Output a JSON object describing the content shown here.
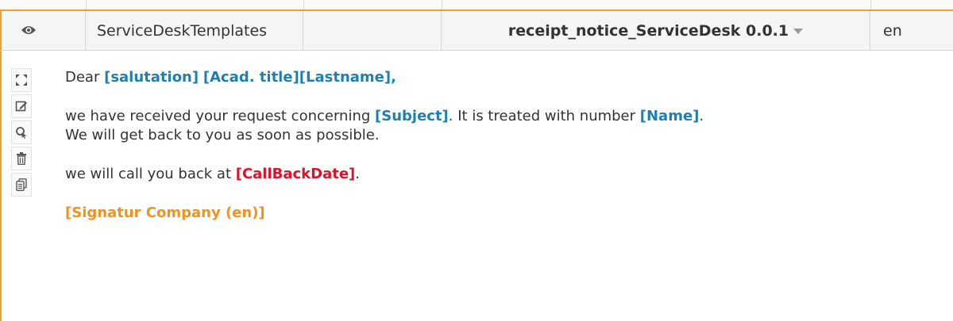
{
  "header": {
    "visibility_icon": "eye-icon",
    "group": "ServiceDeskTemplates",
    "blank": "",
    "template": "receipt_notice_ServiceDesk 0.0.1",
    "template_dropdown_icon": "caret-down-icon",
    "language": "en"
  },
  "toolbar": {
    "items": [
      {
        "icon": "expand-icon"
      },
      {
        "icon": "edit-icon"
      },
      {
        "icon": "search-select-icon"
      },
      {
        "icon": "trash-icon"
      },
      {
        "icon": "copy-icon"
      }
    ]
  },
  "letter": {
    "line1": {
      "prefix": "Dear ",
      "salutation": "[salutation]",
      "space1": " ",
      "acad_title": "[Acad. title]",
      "lastname": "[Lastname]",
      "suffix": ","
    },
    "line2": {
      "prefix": "we have received your request concerning ",
      "subject": "[Subject]",
      "mid": ". It is treated with number ",
      "name": "[Name]",
      "suffix": "."
    },
    "line3": "We will get back to you as soon as possible.",
    "line4": {
      "prefix": "we will call you back at ",
      "callback": "[CallBackDate]",
      "suffix": "."
    },
    "signature": "[Signatur Company (en)]"
  },
  "colors": {
    "accent": "#f0a030",
    "placeholder_blue": "#1f7fb3",
    "placeholder_red": "#e0102a",
    "placeholder_orange": "#f0921e"
  }
}
